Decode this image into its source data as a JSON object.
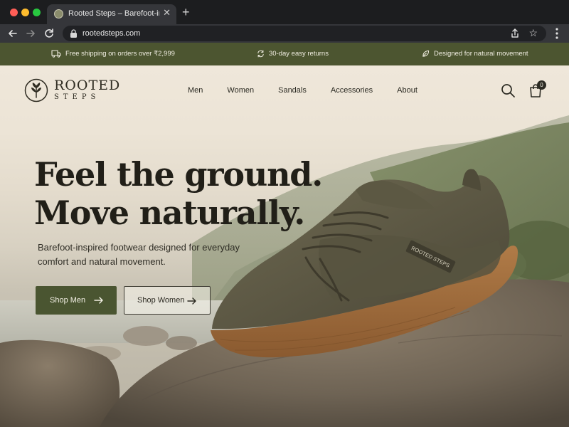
{
  "browser": {
    "tab_title": "Rooted Steps – Barefoot-inspired",
    "tab_close": "✕",
    "new_tab": "+",
    "url": "rootedsteps.com"
  },
  "announcement": {
    "shipping": "Free shipping on orders over ₹2,999",
    "returns": "30-day easy returns",
    "movement": "Designed for natural movement"
  },
  "brand": {
    "word1": "ROOTED",
    "word2": "STEPS"
  },
  "nav": [
    "Men",
    "Women",
    "Sandals",
    "Accessories",
    "About"
  ],
  "cart": {
    "count": "0"
  },
  "hero": {
    "title_line1": "Feel the ground.",
    "title_line2": "Move naturally.",
    "subtitle": "Barefoot-inspired footwear designed for everyday comfort and natural movement.",
    "primary_cta": "Shop Men",
    "secondary_cta": "Shop Women",
    "shoe_tag": "ROOTED STEPS"
  },
  "colors": {
    "brand_green": "#4a5531",
    "announce_bg": "#4c5530",
    "cream": "#efe7da",
    "text_dark": "#211f18"
  }
}
